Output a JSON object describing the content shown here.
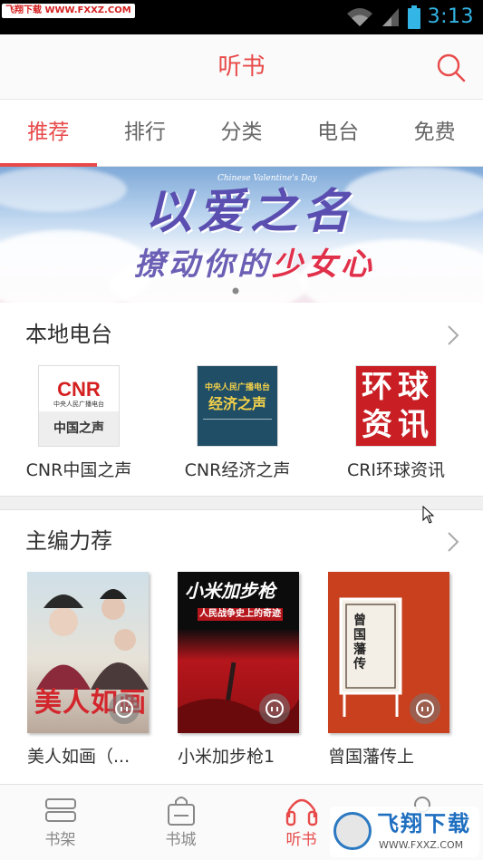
{
  "statusbar": {
    "watermark_text": "飞翔下载 WWW.FXXZ.COM",
    "time": "3:13"
  },
  "header": {
    "title": "听书",
    "search_icon": "search-icon"
  },
  "tabs": [
    {
      "label": "推荐",
      "active": true
    },
    {
      "label": "排行",
      "active": false
    },
    {
      "label": "分类",
      "active": false
    },
    {
      "label": "电台",
      "active": false
    },
    {
      "label": "免费",
      "active": false
    }
  ],
  "banner": {
    "script_text": "以爱之名",
    "sub_text_a": "撩动你的",
    "sub_text_b": "少女心",
    "en_text": "Chinese Valentine's Day"
  },
  "local_radio": {
    "heading": "本地电台",
    "items": [
      {
        "label": "CNR中国之声",
        "logo_big": "CNR",
        "logo_small": "中央人民广播电台",
        "logo_band": "中国之声"
      },
      {
        "label": "CNR经济之声",
        "logo_top": "中央人民广播电台",
        "logo_main": "经济之声"
      },
      {
        "label": "CRI环球资讯",
        "logo_chars": [
          "环",
          "球",
          "资",
          "讯"
        ]
      }
    ]
  },
  "editor_picks": {
    "heading": "主编力荐",
    "items": [
      {
        "label": "美人如画（...",
        "cover_title": "美人如画"
      },
      {
        "label": "小米加步枪1",
        "cover_title": "小米加步枪",
        "cover_sub": "人民战争史上的奇迹"
      },
      {
        "label": "曾国藩传上",
        "cover_title": "曾国藩传"
      }
    ]
  },
  "bottom_nav": [
    {
      "label": "书架",
      "icon": "bookshelf-icon",
      "active": false
    },
    {
      "label": "书城",
      "icon": "bag-icon",
      "active": false
    },
    {
      "label": "听书",
      "icon": "headphones-icon",
      "active": true
    },
    {
      "label": "",
      "icon": "profile-icon",
      "active": false
    }
  ],
  "watermark": {
    "text": "飞翔下载",
    "url": "WWW.FXXZ.COM"
  },
  "colors": {
    "accent": "#e84a4a",
    "status_time": "#33b5e5"
  }
}
